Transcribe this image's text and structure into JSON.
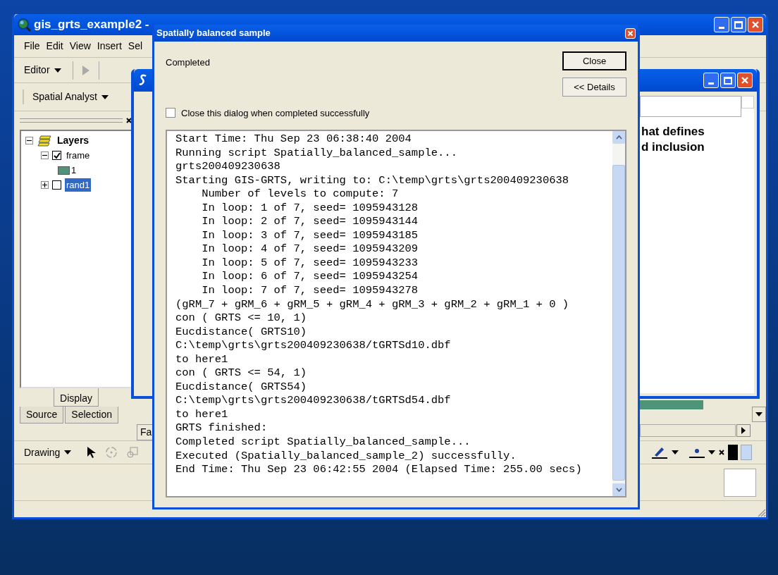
{
  "main_window": {
    "title": "gis_grts_example2 -",
    "menu": [
      "File",
      "Edit",
      "View",
      "Insert",
      "Sel"
    ],
    "toolbars": [
      "Editor",
      "Spatial Analyst"
    ],
    "layers": [
      {
        "label": "Layers",
        "kind": "frame",
        "expanded": true,
        "selected": false,
        "children": [
          {
            "label": "frame",
            "kind": "layer",
            "checked": true,
            "expanded": true,
            "selected": false,
            "children": [
              {
                "label": "1",
                "kind": "symbol",
                "color": "#4f9478"
              }
            ]
          },
          {
            "label": "rand1",
            "kind": "layer",
            "checked": false,
            "expanded": false,
            "selected": true
          }
        ]
      }
    ],
    "toc_tabs": [
      {
        "label": "Display",
        "selected": true
      },
      {
        "label": "Source",
        "selected": false
      },
      {
        "label": "Selection",
        "selected": false
      }
    ],
    "cut_tab": "Fa",
    "drawing_toolbar": "Drawing"
  },
  "back_window": {
    "text_lines": [
      "hat defines",
      "d inclusion"
    ]
  },
  "dialog": {
    "title": "Spatially balanced sample",
    "status": "Completed",
    "buttons": [
      "Close",
      "<< Details"
    ],
    "close_when_done": {
      "label": "Close this dialog when completed successfully",
      "checked": false
    },
    "log": [
      "Start Time: Thu Sep 23 06:38:40 2004",
      "Running script Spatially_balanced_sample...",
      "grts200409230638",
      "Starting GIS-GRTS, writing to: C:\\temp\\grts\\grts200409230638",
      "    Number of levels to compute: 7",
      "    In loop: 1 of 7, seed= 1095943128",
      "    In loop: 2 of 7, seed= 1095943144",
      "    In loop: 3 of 7, seed= 1095943185",
      "    In loop: 4 of 7, seed= 1095943209",
      "    In loop: 5 of 7, seed= 1095943233",
      "    In loop: 6 of 7, seed= 1095943254",
      "    In loop: 7 of 7, seed= 1095943278",
      "(gRM_7 + gRM_6 + gRM_5 + gRM_4 + gRM_3 + gRM_2 + gRM_1 + 0 )",
      "con ( GRTS <= 10, 1)",
      "Eucdistance( GRTS10)",
      "C:\\temp\\grts\\grts200409230638/tGRTSd10.dbf",
      "to here1",
      "con ( GRTS <= 54, 1)",
      "Eucdistance( GRTS54)",
      "C:\\temp\\grts\\grts200409230638/tGRTSd54.dbf",
      "to here1",
      "GRTS finished:",
      "Completed script Spatially_balanced_sample...",
      "Executed (Spatially_balanced_sample_2) successfully.",
      "End Time: Thu Sep 23 06:42:55 2004 (Elapsed Time: 255.00 secs)"
    ]
  }
}
